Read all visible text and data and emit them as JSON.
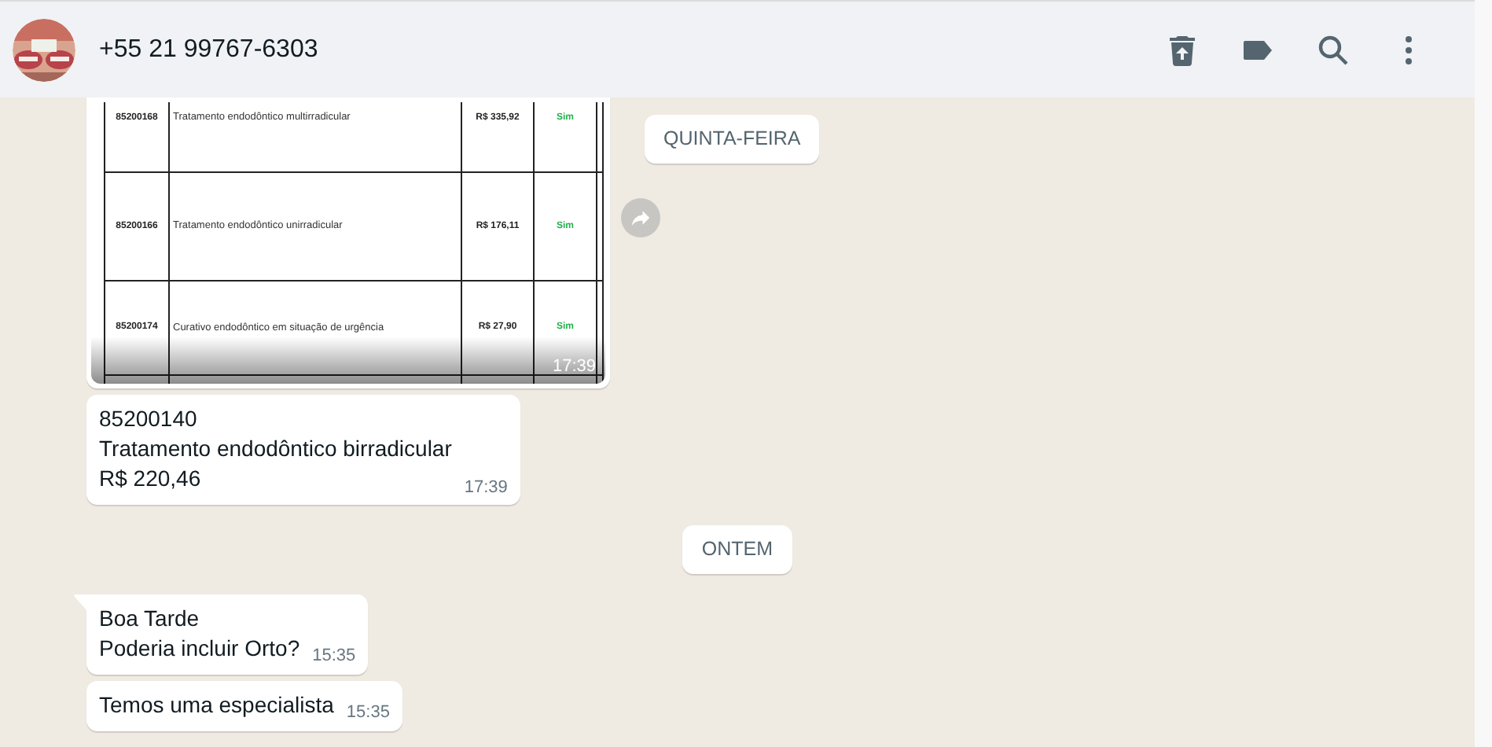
{
  "header": {
    "contact": "+55 21 99767-6303"
  },
  "sticky_date": "QUINTA-FEIRA",
  "messages": [
    {
      "table_rows": [
        {
          "code": "85200168",
          "description": "Tratamento endodôntico multirradicular",
          "price": "R$ 335,92",
          "covered": "Sim"
        },
        {
          "code": "85200166",
          "description": "Tratamento endodôntico unirradicular",
          "price": "R$ 176,11",
          "covered": "Sim"
        },
        {
          "code": "85200174",
          "description": "Curativo endodôntico em situação de urgência",
          "price": "R$ 27,90",
          "covered": "Sim"
        }
      ],
      "time": "17:39"
    },
    {
      "kind": "text",
      "text": "85200140\nTratamento endodôntico birradicular\nR$ 220,46",
      "time": "17:39",
      "tail": false
    },
    {
      "kind": "date",
      "label": "ONTEM"
    },
    {
      "kind": "text",
      "text": "Boa Tarde\nPoderia incluir Orto?",
      "time": "15:35",
      "tail": true
    },
    {
      "kind": "text",
      "text": "Temos uma especialista",
      "time": "15:35",
      "tail": false
    }
  ]
}
